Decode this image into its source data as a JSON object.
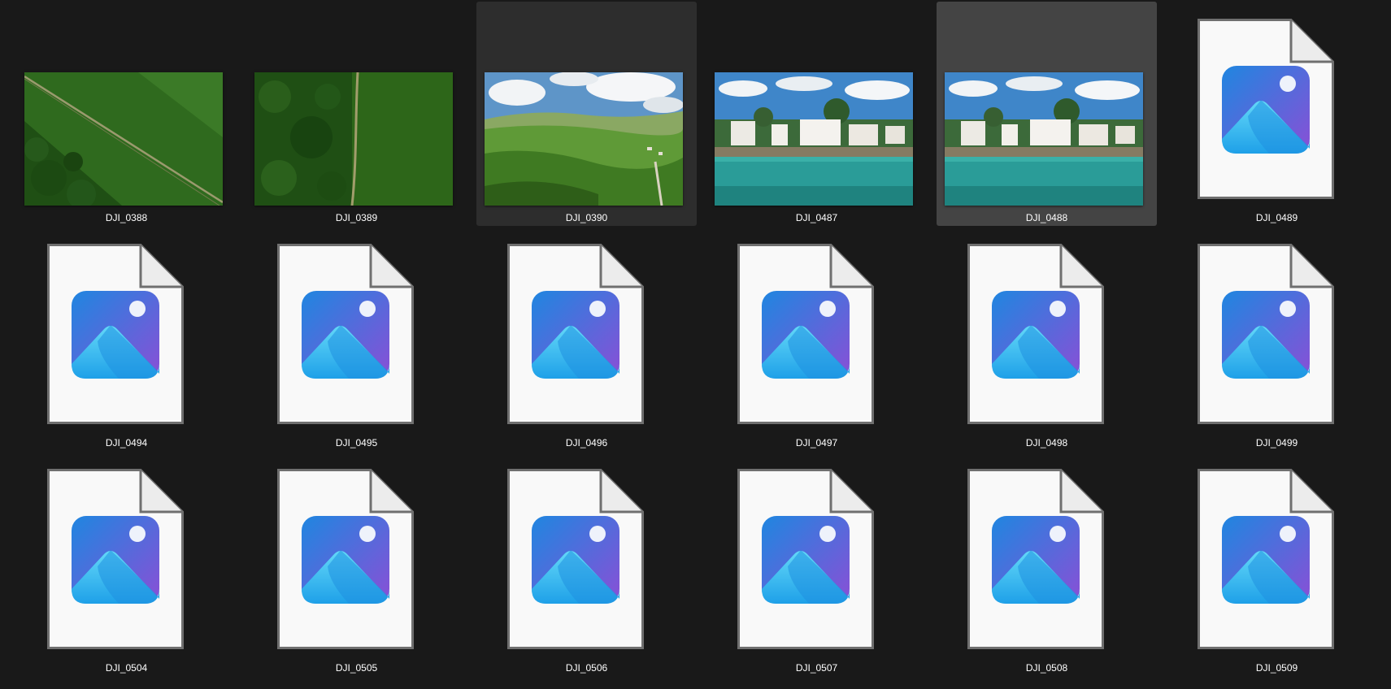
{
  "files": [
    {
      "name": "DJI_0388",
      "kind": "photo",
      "thumb": "field-diagonal",
      "state": "normal"
    },
    {
      "name": "DJI_0389",
      "kind": "photo",
      "thumb": "field-path",
      "state": "normal"
    },
    {
      "name": "DJI_0390",
      "kind": "photo",
      "thumb": "hills",
      "state": "hover"
    },
    {
      "name": "DJI_0487",
      "kind": "photo",
      "thumb": "beach",
      "state": "normal"
    },
    {
      "name": "DJI_0488",
      "kind": "photo",
      "thumb": "beach",
      "state": "selected"
    },
    {
      "name": "DJI_0489",
      "kind": "generic",
      "thumb": "image-file-icon",
      "state": "normal"
    },
    {
      "name": "DJI_0494",
      "kind": "generic",
      "thumb": "image-file-icon",
      "state": "normal"
    },
    {
      "name": "DJI_0495",
      "kind": "generic",
      "thumb": "image-file-icon",
      "state": "normal"
    },
    {
      "name": "DJI_0496",
      "kind": "generic",
      "thumb": "image-file-icon",
      "state": "normal"
    },
    {
      "name": "DJI_0497",
      "kind": "generic",
      "thumb": "image-file-icon",
      "state": "normal"
    },
    {
      "name": "DJI_0498",
      "kind": "generic",
      "thumb": "image-file-icon",
      "state": "normal"
    },
    {
      "name": "DJI_0499",
      "kind": "generic",
      "thumb": "image-file-icon",
      "state": "normal"
    },
    {
      "name": "DJI_0504",
      "kind": "generic",
      "thumb": "image-file-icon",
      "state": "normal"
    },
    {
      "name": "DJI_0505",
      "kind": "generic",
      "thumb": "image-file-icon",
      "state": "normal"
    },
    {
      "name": "DJI_0506",
      "kind": "generic",
      "thumb": "image-file-icon",
      "state": "normal"
    },
    {
      "name": "DJI_0507",
      "kind": "generic",
      "thumb": "image-file-icon",
      "state": "normal"
    },
    {
      "name": "DJI_0508",
      "kind": "generic",
      "thumb": "image-file-icon",
      "state": "normal"
    },
    {
      "name": "DJI_0509",
      "kind": "generic",
      "thumb": "image-file-icon",
      "state": "normal"
    }
  ],
  "colors": {
    "background": "#191919",
    "hover": "#2d2d2d",
    "selected": "#444444",
    "label": "#ffffff"
  }
}
